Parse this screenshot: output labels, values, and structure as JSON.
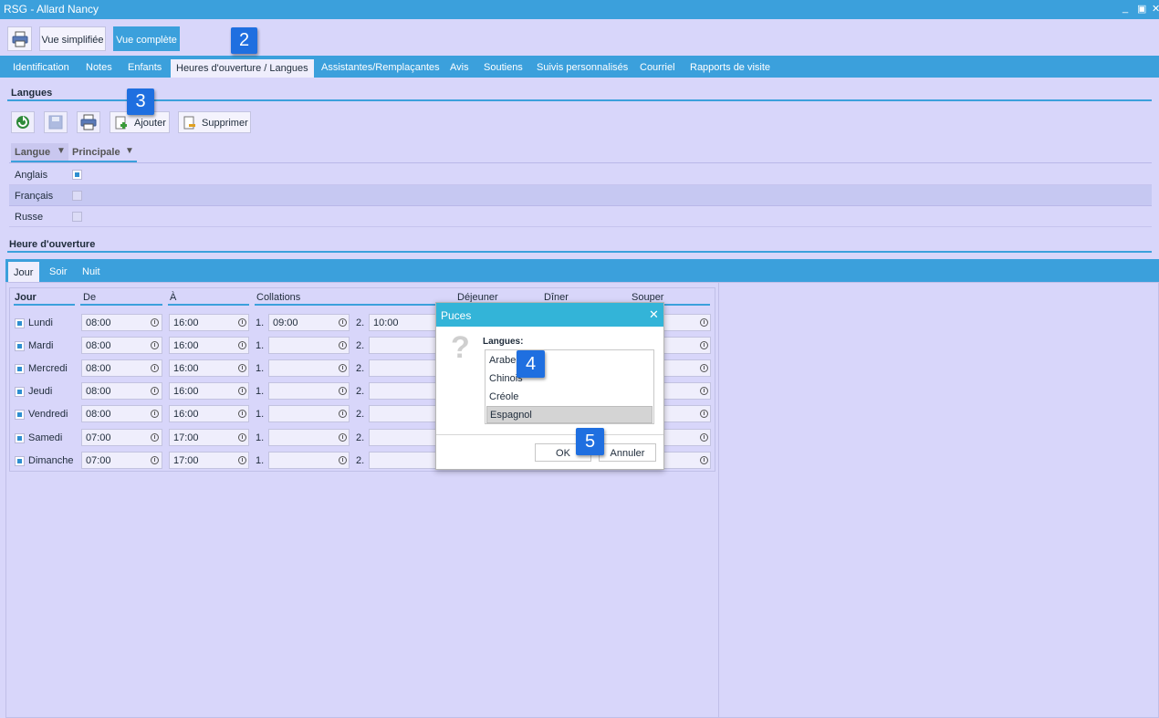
{
  "window": {
    "title": "RSG - Allard Nancy",
    "controls": [
      "_",
      "▣",
      "✕"
    ]
  },
  "toolbar": {
    "print_icon": "printer-icon",
    "simple_view": "Vue simplifiée",
    "full_view": "Vue complète"
  },
  "tabs": [
    "Identification",
    "Notes",
    "Enfants",
    "Heures d'ouverture / Langues",
    "Assistantes/Remplaçantes",
    "Avis",
    "Soutiens",
    "Suivis personnalisés",
    "Courriel",
    "Rapports de visite"
  ],
  "langues": {
    "title": "Langues",
    "add": "Ajouter",
    "delete": "Supprimer",
    "col_langue": "Langue",
    "col_principale": "Principale",
    "rows": [
      {
        "name": "Anglais",
        "principal": true
      },
      {
        "name": "Français",
        "principal": false
      },
      {
        "name": "Russe",
        "principal": false
      }
    ]
  },
  "hours": {
    "title": "Heure d'ouverture",
    "subtabs": [
      "Jour",
      "Soir",
      "Nuit"
    ],
    "headers": {
      "jour": "Jour",
      "de": "De",
      "a": "À",
      "collations": "Collations",
      "dejeuner": "Déjeuner",
      "diner": "Dîner",
      "souper": "Souper"
    },
    "snack1_prefix": "1.",
    "snack2_prefix": "2.",
    "days": [
      {
        "name": "Lundi",
        "from": "08:00",
        "to": "16:00",
        "snack1": "09:00",
        "snack2": "10:00"
      },
      {
        "name": "Mardi",
        "from": "08:00",
        "to": "16:00",
        "snack1": "",
        "snack2": ""
      },
      {
        "name": "Mercredi",
        "from": "08:00",
        "to": "16:00",
        "snack1": "",
        "snack2": ""
      },
      {
        "name": "Jeudi",
        "from": "08:00",
        "to": "16:00",
        "snack1": "",
        "snack2": ""
      },
      {
        "name": "Vendredi",
        "from": "08:00",
        "to": "16:00",
        "snack1": "",
        "snack2": ""
      },
      {
        "name": "Samedi",
        "from": "07:00",
        "to": "17:00",
        "snack1": "",
        "snack2": ""
      },
      {
        "name": "Dimanche",
        "from": "07:00",
        "to": "17:00",
        "snack1": "",
        "snack2": ""
      }
    ]
  },
  "dialog": {
    "title": "Puces",
    "label": "Langues:",
    "items": [
      "Arabe",
      "Chinois",
      "Créole",
      "Espagnol"
    ],
    "selected_index": 3,
    "ok": "OK",
    "cancel": "Annuler"
  },
  "badges": [
    "2",
    "3",
    "4",
    "5"
  ],
  "colors": {
    "accent": "#3ba0dc",
    "background": "#d8d6fa",
    "badge": "#1f6fe0",
    "dialog_header": "#33b4d8"
  }
}
